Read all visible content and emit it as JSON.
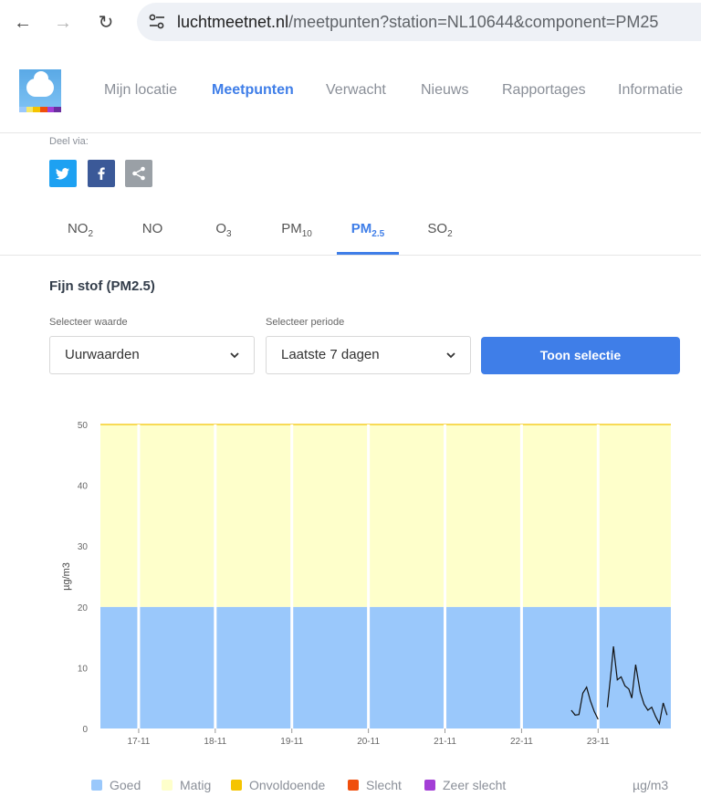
{
  "browser": {
    "url_host": "luchtmeetnet.nl",
    "url_rest": "/meetpunten?station=NL10644&component=PM25"
  },
  "nav": {
    "items": [
      "Mijn locatie",
      "Meetpunten",
      "Verwacht",
      "Nieuws",
      "Rapportages",
      "Informatie"
    ],
    "active_index": 1
  },
  "share": {
    "label": "Deel via:",
    "twitter_color": "#1da1f2",
    "facebook_color": "#3b5998",
    "share_color": "#9aa0a6"
  },
  "tabs": [
    {
      "base": "NO",
      "sub": "2"
    },
    {
      "base": "NO",
      "sub": ""
    },
    {
      "base": "O",
      "sub": "3"
    },
    {
      "base": "PM",
      "sub": "10"
    },
    {
      "base": "PM",
      "sub": "2.5"
    },
    {
      "base": "SO",
      "sub": "2"
    }
  ],
  "active_tab": 4,
  "section_title": "Fijn stof (PM2.5)",
  "filters": {
    "value_label": "Selecteer waarde",
    "value_selected": "Uurwaarden",
    "period_label": "Selecteer periode",
    "period_selected": "Laatste 7 dagen",
    "submit_label": "Toon selectie"
  },
  "colors": {
    "accent": "#3f7ee8",
    "goed": "#9ac8fb",
    "matig": "#feffcb",
    "onvoldoende": "#f5c400",
    "slecht": "#f04e0c",
    "zeer_slecht": "#a33ed6"
  },
  "legend": {
    "items": [
      "Goed",
      "Matig",
      "Onvoldoende",
      "Slecht",
      "Zeer slecht"
    ],
    "unit": "µg/m3"
  },
  "chart_data": {
    "type": "line",
    "ylabel": "µg/m3",
    "ylim": [
      0,
      50
    ],
    "yticks": [
      0,
      10,
      20,
      30,
      40,
      50
    ],
    "x_ticks": [
      "17-11",
      "18-11",
      "19-11",
      "20-11",
      "21-11",
      "22-11",
      "23-11"
    ],
    "bands": [
      {
        "name": "Goed",
        "from": 0,
        "to": 20
      },
      {
        "name": "Matig",
        "from": 20,
        "to": 50
      }
    ],
    "grid": false,
    "series": [
      {
        "segments": [
          [
            [
              6.65,
              3.0
            ],
            [
              6.7,
              2.2
            ],
            [
              6.75,
              2.3
            ],
            [
              6.8,
              5.8
            ],
            [
              6.85,
              6.8
            ],
            [
              6.9,
              4.5
            ],
            [
              6.95,
              2.8
            ],
            [
              7.0,
              1.5
            ]
          ],
          [
            [
              7.12,
              3.5
            ],
            [
              7.17,
              9.5
            ],
            [
              7.2,
              13.5
            ],
            [
              7.25,
              8.0
            ],
            [
              7.3,
              8.5
            ],
            [
              7.35,
              7.0
            ],
            [
              7.4,
              6.5
            ],
            [
              7.44,
              5.0
            ],
            [
              7.49,
              10.5
            ],
            [
              7.55,
              6.0
            ],
            [
              7.6,
              4.0
            ],
            [
              7.65,
              3.0
            ],
            [
              7.7,
              3.5
            ],
            [
              7.75,
              2.0
            ],
            [
              7.8,
              0.8
            ],
            [
              7.85,
              4.2
            ],
            [
              7.9,
              2.2
            ]
          ]
        ]
      }
    ]
  }
}
